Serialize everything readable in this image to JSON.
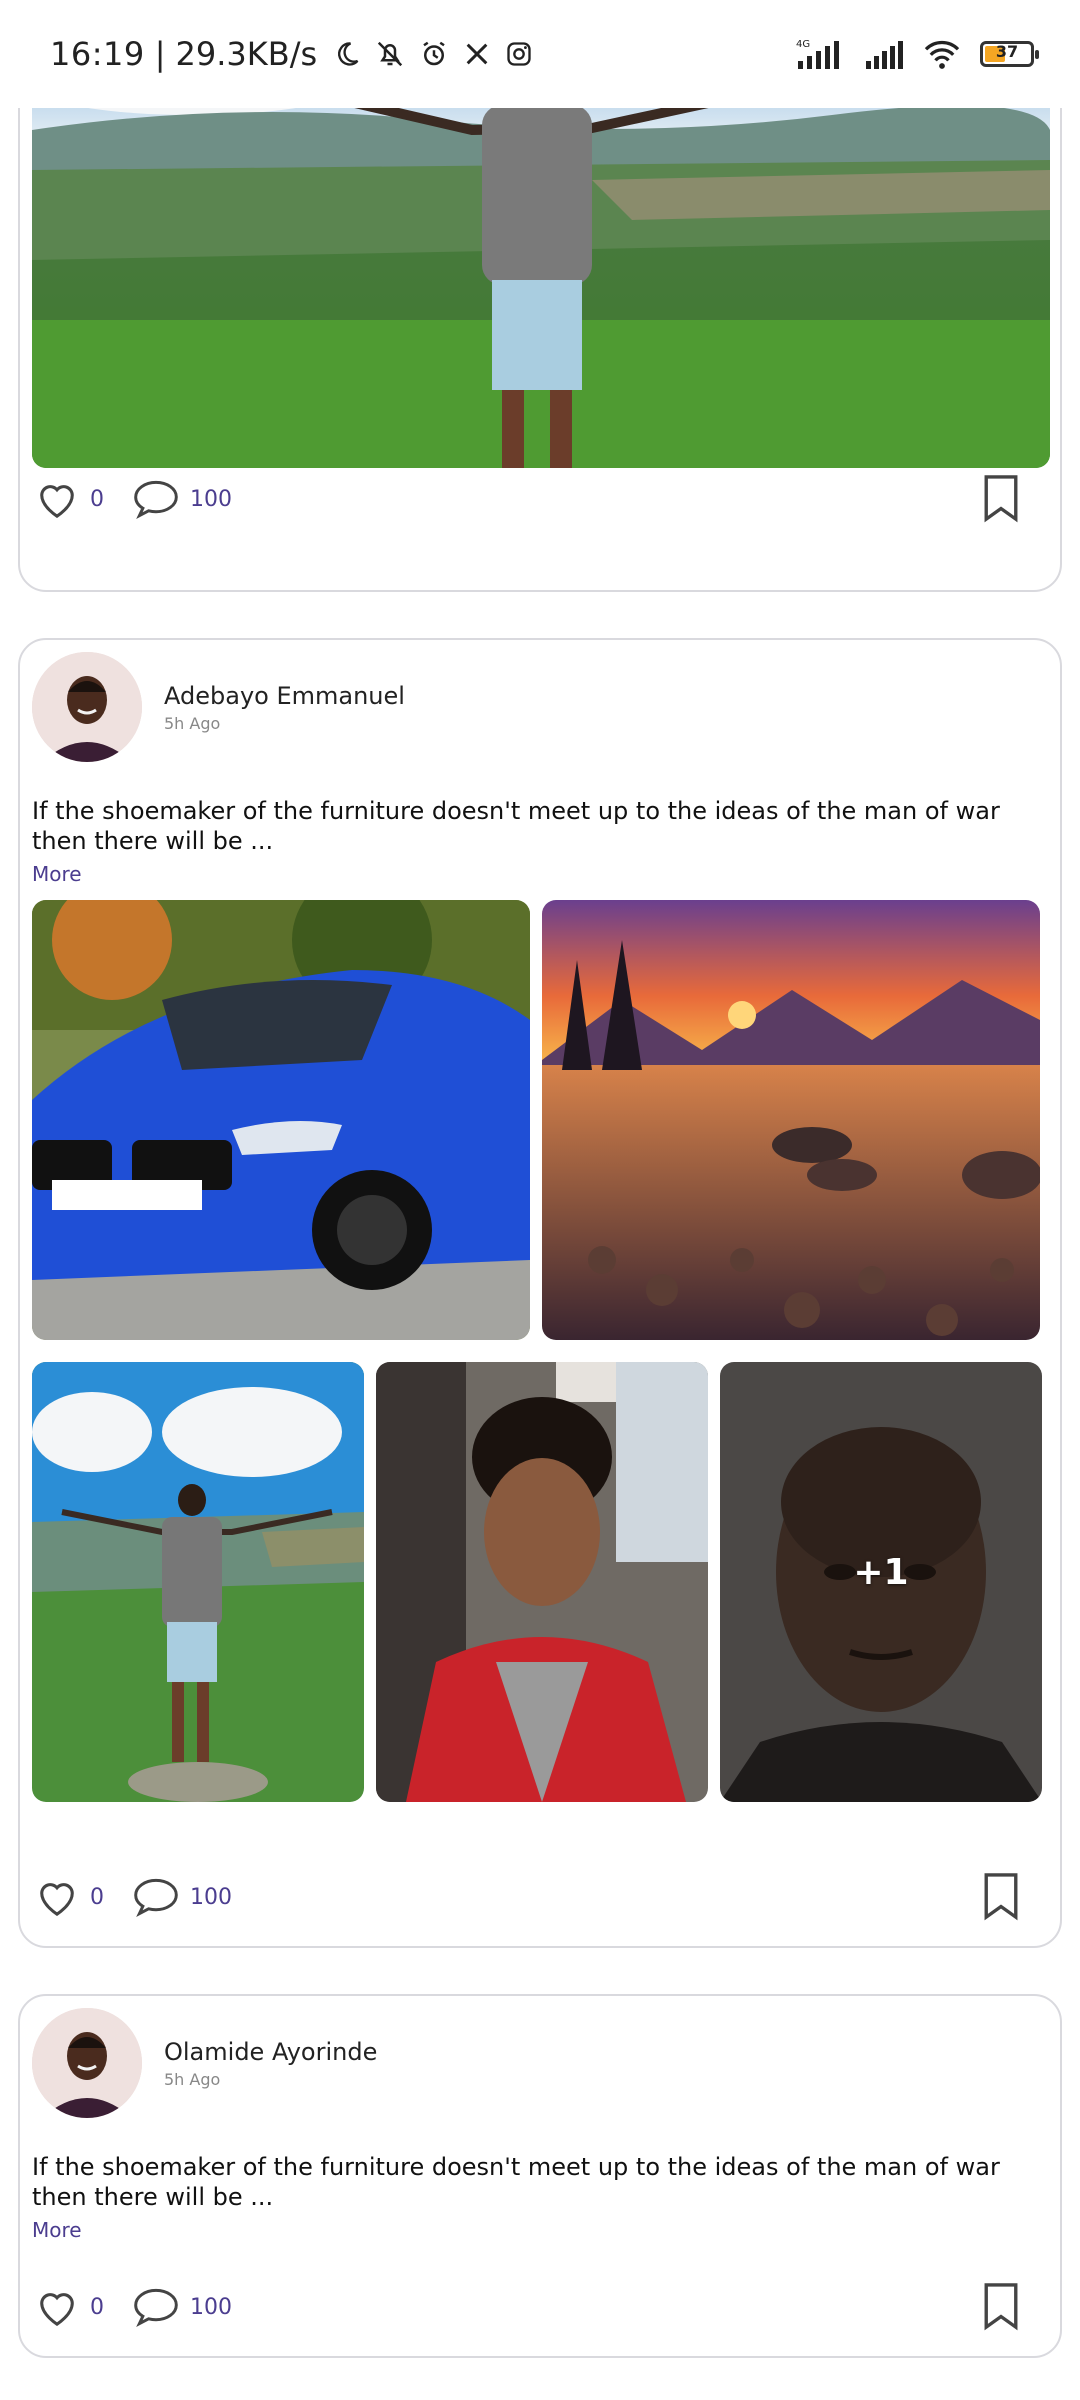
{
  "status_bar": {
    "time": "16:19",
    "net_speed": "29.3KB/s",
    "battery": "37",
    "icons": [
      "moon-icon",
      "bell-off-icon",
      "alarm-icon",
      "x-logo-icon",
      "instagram-icon",
      "signal-4g-icon",
      "signal-icon",
      "wifi-icon",
      "battery-icon"
    ]
  },
  "posts": [
    {
      "images": [
        "landscape-man-arms-out"
      ],
      "likes": "0",
      "comments": "100"
    },
    {
      "author": "Adebayo Emmanuel",
      "time": "5h Ago",
      "text": "If the shoemaker of the furniture doesn't meet up to the ideas of the man of war then there will be ...",
      "more_label": "More",
      "images": [
        "blue-bmw-car",
        "sunset-lake-mountains",
        "man-arms-out-cliff",
        "young-man-red-jacket",
        "older-man-portrait"
      ],
      "extra_images_label": "+1",
      "likes": "0",
      "comments": "100"
    },
    {
      "author": "Olamide Ayorinde",
      "time": "5h Ago",
      "text": "If the shoemaker of the furniture doesn't meet up to the ideas of the man of war then there will be ...",
      "more_label": "More",
      "likes": "0",
      "comments": "100"
    }
  ],
  "colors": {
    "accent": "#4b3d8f",
    "border": "#d9d9de",
    "battery_fill": "#f5a623"
  }
}
